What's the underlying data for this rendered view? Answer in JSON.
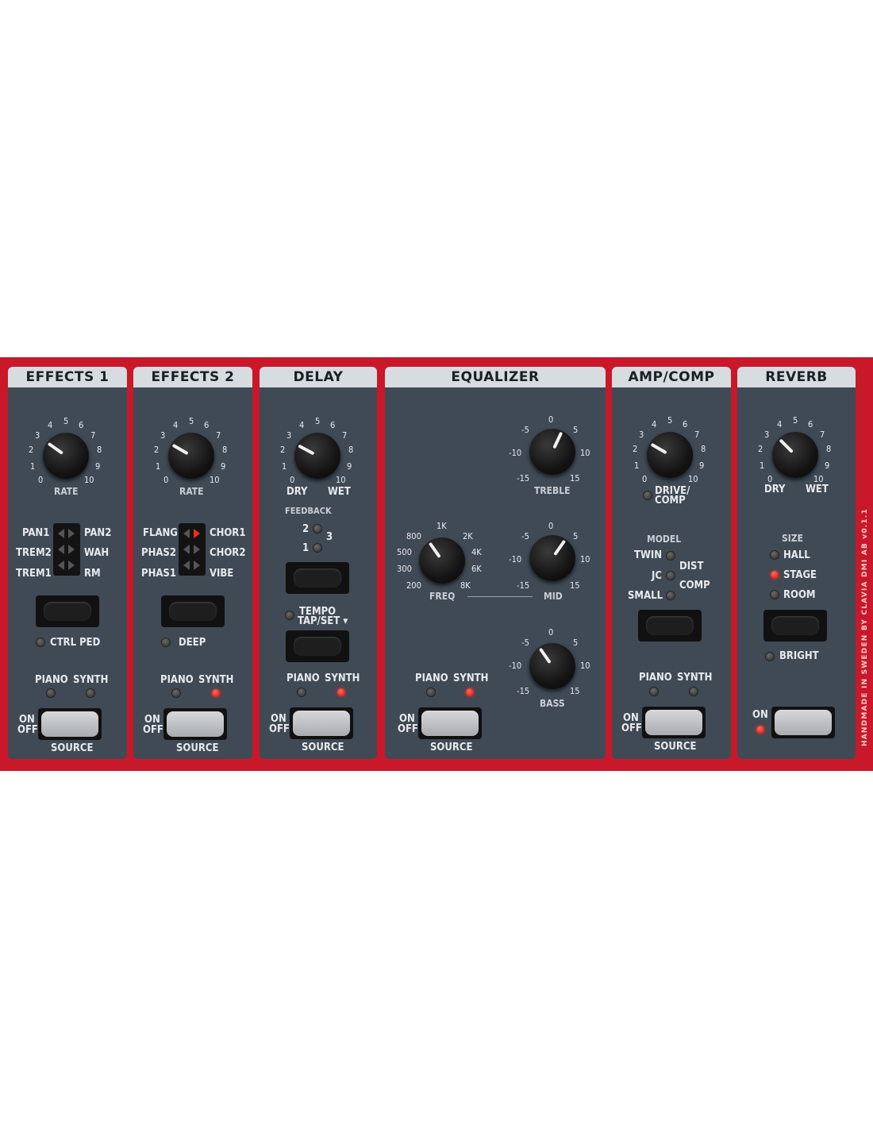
{
  "effects1": {
    "title": "EFFECTS 1",
    "rate_scale": [
      "0",
      "1",
      "2",
      "3",
      "4",
      "5",
      "6",
      "7",
      "8",
      "9",
      "10"
    ],
    "rate_label": "RATE",
    "left_labels": [
      "PAN1",
      "TREM2",
      "TREM1"
    ],
    "right_labels": [
      "PAN2",
      "WAH",
      "RM"
    ],
    "ctrl_label": "CTRL PED",
    "piano_label": "PIANO",
    "synth_label": "SYNTH",
    "on_label": "ON",
    "off_label": "OFF",
    "source_label": "SOURCE"
  },
  "effects2": {
    "title": "EFFECTS 2",
    "rate_scale": [
      "0",
      "1",
      "2",
      "3",
      "4",
      "5",
      "6",
      "7",
      "8",
      "9",
      "10"
    ],
    "rate_label": "RATE",
    "left_labels": [
      "FLANG",
      "PHAS2",
      "PHAS1"
    ],
    "right_labels": [
      "CHOR1",
      "CHOR2",
      "VIBE"
    ],
    "deep_label": "DEEP",
    "piano_label": "PIANO",
    "synth_label": "SYNTH",
    "on_label": "ON",
    "off_label": "OFF",
    "source_label": "SOURCE"
  },
  "delay": {
    "title": "DELAY",
    "scale": [
      "0",
      "1",
      "2",
      "3",
      "4",
      "5",
      "6",
      "7",
      "8",
      "9",
      "10"
    ],
    "dry_label": "DRY",
    "wet_label": "WET",
    "feedback_label": "FEEDBACK",
    "fb_2": "2",
    "fb_3": "3",
    "fb_1": "1",
    "tempo_label": "TEMPO",
    "tapset_label": "TAP/SET ▾",
    "piano_label": "PIANO",
    "synth_label": "SYNTH",
    "on_label": "ON",
    "off_label": "OFF",
    "source_label": "SOURCE"
  },
  "equalizer": {
    "title": "EQUALIZER",
    "freq_scale": [
      "200",
      "300",
      "500",
      "800",
      "1K",
      "2K",
      "4K",
      "6K",
      "8K"
    ],
    "freq_label": "FREQ",
    "gain_scale": [
      "-15",
      "-10",
      "-5",
      "0",
      "5",
      "10",
      "15"
    ],
    "treble_label": "TREBLE",
    "mid_label": "MID",
    "bass_label": "BASS",
    "piano_label": "PIANO",
    "synth_label": "SYNTH",
    "on_label": "ON",
    "off_label": "OFF",
    "source_label": "SOURCE"
  },
  "ampcomp": {
    "title": "AMP/COMP",
    "scale": [
      "0",
      "1",
      "2",
      "3",
      "4",
      "5",
      "6",
      "7",
      "8",
      "9",
      "10"
    ],
    "drive_label": "DRIVE/",
    "comp_label": "COMP",
    "model_label": "MODEL",
    "twin_label": "TWIN",
    "jc_label": "JC",
    "small_label": "SMALL",
    "dist_label": "DIST",
    "comp2_label": "COMP",
    "piano_label": "PIANO",
    "synth_label": "SYNTH",
    "on_label": "ON",
    "off_label": "OFF",
    "source_label": "SOURCE"
  },
  "reverb": {
    "title": "REVERB",
    "scale": [
      "0",
      "1",
      "2",
      "3",
      "4",
      "5",
      "6",
      "7",
      "8",
      "9",
      "10"
    ],
    "dry_label": "DRY",
    "wet_label": "WET",
    "size_label": "SIZE",
    "hall_label": "HALL",
    "stage_label": "STAGE",
    "room_label": "ROOM",
    "bright_label": "BRIGHT",
    "on_label": "ON"
  },
  "footer": {
    "vertical_text": "HANDMADE IN SWEDEN BY CLAVIA DMI AB   v0.1.1"
  }
}
